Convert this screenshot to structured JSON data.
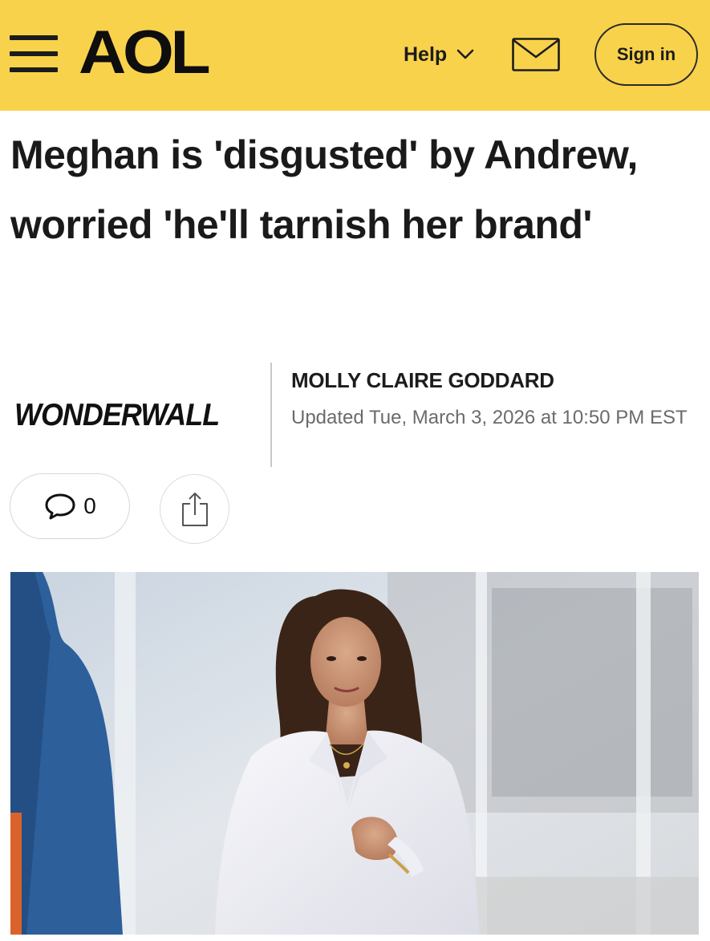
{
  "header": {
    "menu_icon": "hamburger-menu-icon",
    "logo_text": "AOL",
    "help_label": "Help",
    "help_icon": "chevron-down-icon",
    "mail_icon": "envelope-icon",
    "signin_label": "Sign in",
    "bar_color": "#f8d24b"
  },
  "article": {
    "headline": "Meghan is 'disgusted' by Andrew, worried 'he'll tarnish her brand'",
    "source_name": "WONDERWALL",
    "author": "MOLLY CLAIRE GODDARD",
    "updated": "Updated Tue, March 3, 2026 at 10:50 PM EST",
    "comment_count": "0",
    "comment_icon": "speech-bubble-icon",
    "share_icon": "share-icon",
    "hero_image": "photo of a woman with long dark hair in a white blazer, outdoors"
  }
}
